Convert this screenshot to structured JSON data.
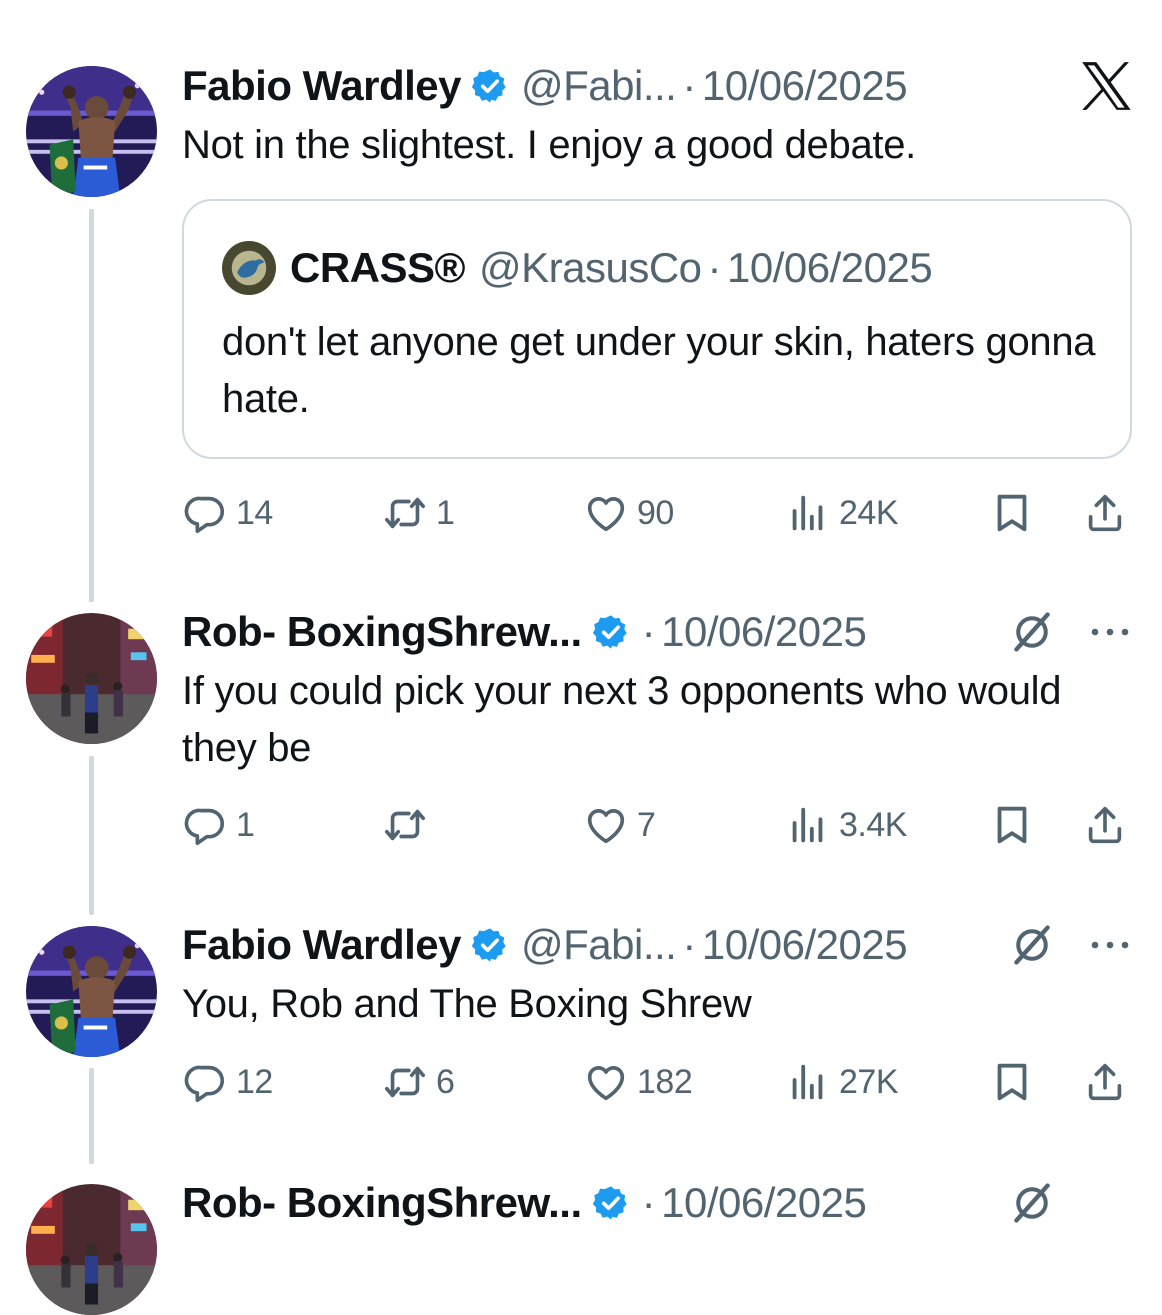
{
  "brand_colors": {
    "verified_blue": "#1d9bf0",
    "secondary_text": "#536471",
    "primary_text": "#0f1419",
    "thread_line": "#cfd9de"
  },
  "tweets": [
    {
      "name": "Fabio Wardley",
      "handle": "@Fabi...",
      "dot": "·",
      "date": "10/06/2025",
      "text": "Not in the slightest. I enjoy a good debate.",
      "quote": {
        "name": "CRASS®",
        "handle": "@KrasusCo",
        "dot": "·",
        "date": "10/06/2025",
        "text": "don't let anyone get under your skin, haters gonna hate."
      },
      "replies": "14",
      "reposts": "1",
      "likes": "90",
      "views": "24K"
    },
    {
      "name": "Rob- BoxingShrew...",
      "handle": "",
      "dot": "·",
      "date": "10/06/2025",
      "text": "If you could pick your next 3 opponents who would they be",
      "replies": "1",
      "reposts": "",
      "likes": "7",
      "views": "3.4K"
    },
    {
      "name": "Fabio Wardley",
      "handle": "@Fabi...",
      "dot": "·",
      "date": "10/06/2025",
      "text": "You, Rob and The Boxing Shrew",
      "replies": "12",
      "reposts": "6",
      "likes": "182",
      "views": "27K"
    },
    {
      "name": "Rob- BoxingShrew...",
      "dot": "·",
      "date": "10/06/2025"
    }
  ],
  "icons": {
    "verified": "verified-badge-icon",
    "platform_logo": "x-logo-icon",
    "reply": "reply-icon",
    "repost": "repost-icon",
    "like": "heart-icon",
    "views": "views-icon",
    "bookmark": "bookmark-icon",
    "share": "share-icon",
    "grok": "grok-icon",
    "more": "more-icon"
  }
}
